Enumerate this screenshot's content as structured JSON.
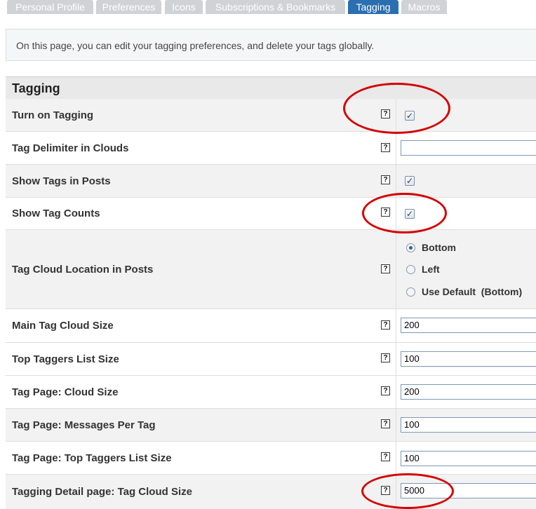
{
  "tabs": [
    "Personal Profile",
    "Preferences",
    "Icons",
    "Subscriptions & Bookmarks",
    "Tagging",
    "Macros"
  ],
  "intro": "On this page, you can edit your tagging preferences, and delete your tags globally.",
  "section_title": "Tagging",
  "help_glyph": "?",
  "check_glyph": "✓",
  "rows": {
    "turn_on_tagging": {
      "label": "Turn on Tagging",
      "checked": true
    },
    "tag_delimiter": {
      "label": "Tag Delimiter in Clouds",
      "value": ""
    },
    "show_tags_in_posts": {
      "label": "Show Tags in Posts",
      "checked": true
    },
    "show_tag_counts": {
      "label": "Show Tag Counts",
      "checked": true
    },
    "tag_cloud_location": {
      "label": "Tag Cloud Location in Posts",
      "options": [
        "Bottom",
        "Left",
        "Use Default  (Bottom)"
      ],
      "selected": "Bottom"
    },
    "main_tag_cloud_size": {
      "label": "Main Tag Cloud Size",
      "value": "200"
    },
    "top_taggers_list_size": {
      "label": "Top Taggers List Size",
      "value": "100"
    },
    "tag_page_cloud_size": {
      "label": "Tag Page: Cloud Size",
      "value": "200"
    },
    "tag_page_messages_per_tag": {
      "label": "Tag Page: Messages Per Tag",
      "value": "100"
    },
    "tag_page_top_taggers": {
      "label": "Tag Page: Top Taggers List Size",
      "value": "100"
    },
    "tagging_detail_cloud_size": {
      "label": "Tagging Detail page: Tag Cloud Size",
      "value": "5000"
    }
  },
  "colors": {
    "annotation": "#d40000",
    "active_tab": "#2a6fb0",
    "inactive_tab": "#cfd3d6"
  }
}
